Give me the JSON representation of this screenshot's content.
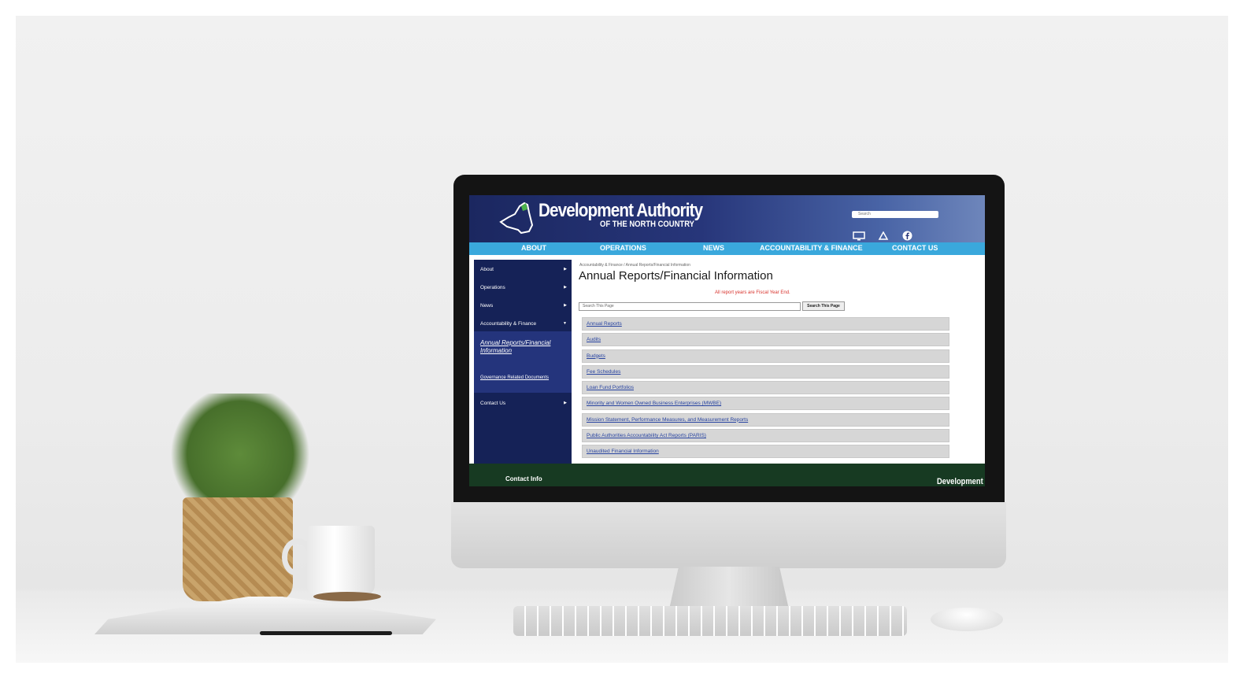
{
  "site": {
    "logo_title": "Development Authority",
    "logo_subtitle": "OF THE NORTH COUNTRY",
    "header_search_placeholder": "Search",
    "header_icons": [
      "monitor-icon",
      "recycle-icon",
      "facebook-icon"
    ]
  },
  "nav": {
    "items": [
      "ABOUT",
      "OPERATIONS",
      "NEWS",
      "ACCOUNTABILITY & FINANCE",
      "CONTACT US"
    ]
  },
  "sidebar": {
    "items": [
      "About",
      "Operations",
      "News",
      "Accountability & Finance"
    ],
    "sub_items": [
      "Annual Reports/Financial Information",
      "Governance Related Documents"
    ],
    "contact": "Contact Us"
  },
  "breadcrumb": "Accountability & Finance  /  Annual Reports/Financial Information",
  "page_title": "Annual Reports/Financial Information",
  "fiscal_note": "All report years are Fiscal Year End.",
  "page_search": {
    "placeholder": "Search This Page",
    "button": "Search This Page"
  },
  "links": [
    "Annual Reports",
    "Audits",
    "Budgets",
    "Fee Schedules",
    "Loan Fund Portfolios",
    "Minority and Women Owned Business Enterprises (MWBE)",
    "Mission Statement, Performance Measures, and Measurement Reports",
    "Public Authorities Accountability Act Reports (PARIS)",
    "Unaudited Financial Information"
  ],
  "footer": {
    "contact_label": "Contact Info",
    "brand": "Development"
  },
  "colors": {
    "header_dark": "#1b2760",
    "nav_blue": "#3aa8dc",
    "sidebar_navy": "#152257",
    "note_red": "#d8322c",
    "footer_green": "#173a22",
    "link_blue": "#2743a0"
  }
}
